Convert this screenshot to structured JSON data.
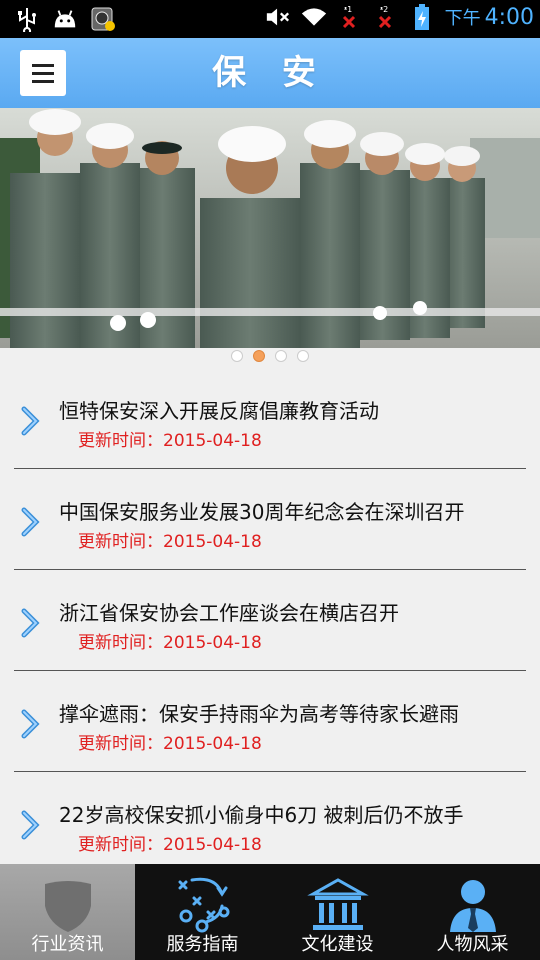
{
  "status_bar": {
    "time_prefix": "下午",
    "time": "4:00",
    "icons": [
      "usb-icon",
      "android-icon",
      "app-notification-icon",
      "mute-icon",
      "wifi-icon",
      "signal-1-no-service-icon",
      "signal-2-no-service-icon",
      "battery-charging-icon"
    ]
  },
  "header": {
    "title": "保 安",
    "menu_icon": "hamburger-menu-icon",
    "color": "#6bb6f8"
  },
  "banner": {
    "slide_count": 4,
    "active_slide": 2
  },
  "news": [
    {
      "headline": "恒特保安深入开展反腐倡廉教育活动",
      "date": "更新时间：2015-04-18"
    },
    {
      "headline": "中国保安服务业发展30周年纪念会在深圳召开",
      "date": "更新时间：2015-04-18"
    },
    {
      "headline": "浙江省保安协会工作座谈会在横店召开",
      "date": "更新时间：2015-04-18"
    },
    {
      "headline": "撑伞遮雨：保安手持雨伞为高考等待家长避雨",
      "date": "更新时间：2015-04-18"
    },
    {
      "headline": "22岁高校保安抓小偷身中6刀 被刺后仍不放手",
      "date": "更新时间：2015-04-18"
    }
  ],
  "tabs": [
    {
      "label": "行业资讯",
      "icon": "shield-icon",
      "active": true
    },
    {
      "label": "服务指南",
      "icon": "strategy-play-icon",
      "active": false
    },
    {
      "label": "文化建设",
      "icon": "building-columns-icon",
      "active": false
    },
    {
      "label": "人物风采",
      "icon": "person-tie-icon",
      "active": false
    }
  ],
  "colors": {
    "accent": "#5aa9f1",
    "date_red": "#e02020",
    "chevron_blue": "#3a8fd8"
  }
}
